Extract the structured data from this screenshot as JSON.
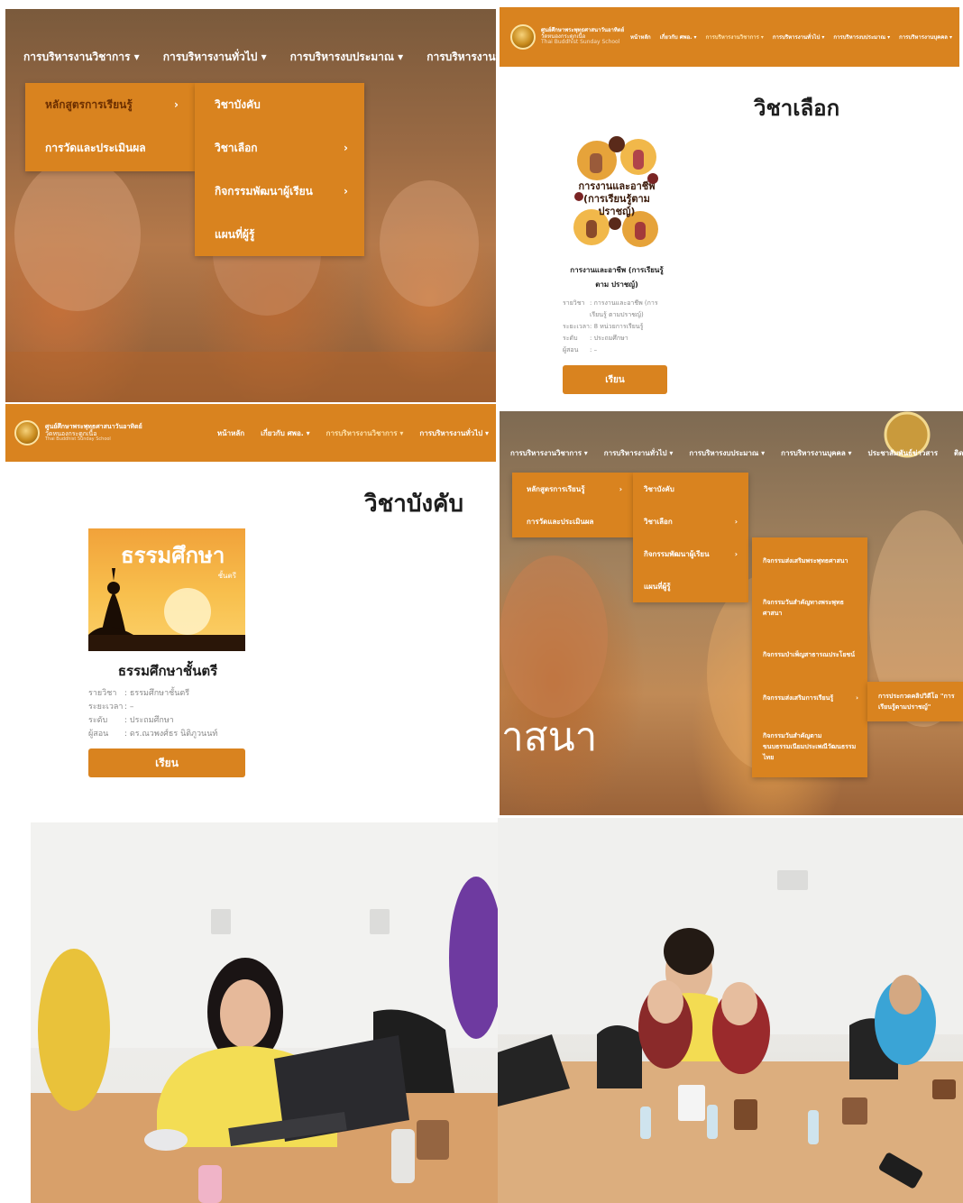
{
  "panel_menu_home": {
    "topnav": [
      {
        "label": "การบริหารงานวิชาการ ▾"
      },
      {
        "label": "การบริหารงานทั่วไป ▾"
      },
      {
        "label": "การบริหารงบประมาณ ▾"
      },
      {
        "label": "การบริหารงานบุคคล ▾"
      }
    ],
    "dropdown_level1": [
      {
        "label": "หลักสูตรการเรียนรู้",
        "arrow": "›"
      },
      {
        "label": "การวัดและประเมินผล",
        "arrow": ""
      }
    ],
    "dropdown_level2": [
      {
        "label": "วิชาบังคับ",
        "arrow": ""
      },
      {
        "label": "วิชาเลือก",
        "arrow": "›"
      },
      {
        "label": "กิจกรรมพัฒนาผู้เรียน",
        "arrow": "›"
      },
      {
        "label": "แผนที่ผู้รู้",
        "arrow": ""
      }
    ]
  },
  "panel_elective": {
    "header": {
      "brand_line1": "ศูนย์ศึกษาพระพุทธศาสนาวันอาทิตย์",
      "brand_line2": "วัดหนองกระดูกเนื้อ",
      "brand_line3": "Thai Buddhist Sunday School",
      "nav": [
        {
          "label": "หน้าหลัก"
        },
        {
          "label": "เกี่ยวกับ ศพอ. ▾"
        },
        {
          "label": "การบริหารงานวิชาการ ▾"
        },
        {
          "label": "การบริหารงานทั่วไป ▾"
        },
        {
          "label": "การบริหารงบประมาณ ▾"
        },
        {
          "label": "การบริหารงานบุคคล ▾"
        }
      ]
    },
    "title": "วิชาเลือก",
    "cover_text": "การงานและอาชีพ (การเรียนรู้ตามปราชญ์)",
    "course_name": "การงานและอาชีพ (การเรียนรู้ตาม ปราชญ์)",
    "meta": [
      {
        "k": "รายวิชา",
        "v": ": การงานและอาชีพ (การเรียนรู้ ตามปราชญ์)"
      },
      {
        "k": "ระยะเวลา",
        "v": ": 8 หน่วยการเรียนรู้"
      },
      {
        "k": "ระดับ",
        "v": ": ประถมศึกษา"
      },
      {
        "k": "ผู้สอน",
        "v": ": –"
      }
    ],
    "button": "เรียน"
  },
  "panel_compulsory": {
    "header": {
      "brand_line1": "ศูนย์ศึกษาพระพุทธศาสนาวันอาทิตย์",
      "brand_line2": "วัดหนองกระดูกเนื้อ",
      "brand_line3": "Thai Buddhist Sunday School",
      "nav": [
        {
          "label": "หน้าหลัก"
        },
        {
          "label": "เกี่ยวกับ ศพอ. ▾"
        },
        {
          "label": "การบริหารงานวิชาการ ▾"
        },
        {
          "label": "การบริหารงานทั่วไป ▾"
        }
      ]
    },
    "title": "วิชาบังคับ",
    "cover_title": "ธรรมศึกษา",
    "cover_sub": "ชั้นตรี",
    "course_name": "ธรรมศึกษาชั้นตรี",
    "meta": [
      {
        "k": "รายวิชา",
        "v": ": ธรรมศึกษาชั้นตรี"
      },
      {
        "k": "ระยะเวลา",
        "v": ": –"
      },
      {
        "k": "ระดับ",
        "v": ": ประถมศึกษา"
      },
      {
        "k": "ผู้สอน",
        "v": ": ดร.ณวพงศ์ธร นิติภูวนนท์"
      }
    ],
    "button": "เรียน"
  },
  "panel_menu_activity": {
    "topnav": [
      {
        "label": "การบริหารงานวิชาการ ▾"
      },
      {
        "label": "การบริหารงานทั่วไป ▾"
      },
      {
        "label": "การบริหารงบประมาณ ▾"
      },
      {
        "label": "การบริหารงานบุคคล ▾"
      },
      {
        "label": "ประชาสัมพันธ์ข่าวสาร"
      },
      {
        "label": "ติดต่อเรา"
      }
    ],
    "dropdown_level1": [
      {
        "label": "หลักสูตรการเรียนรู้",
        "arrow": "›"
      },
      {
        "label": "การวัดและประเมินผล",
        "arrow": ""
      }
    ],
    "dropdown_level2": [
      {
        "label": "วิชาบังคับ",
        "arrow": ""
      },
      {
        "label": "วิชาเลือก",
        "arrow": "›"
      },
      {
        "label": "กิจกรรมพัฒนาผู้เรียน",
        "arrow": "›"
      },
      {
        "label": "แผนที่ผู้รู้",
        "arrow": ""
      }
    ],
    "dropdown_level3": [
      {
        "label": "กิจกรรมส่งเสริมพระพุทธศาสนา",
        "arrow": ""
      },
      {
        "label": "กิจกรรมวันสำคัญทางพระพุทธศาสนา",
        "arrow": ""
      },
      {
        "label": "กิจกรรมบำเพ็ญสาธารณประโยชน์",
        "arrow": ""
      },
      {
        "label": "กิจกรรมส่งเสริมการเรียนรู้",
        "arrow": "›"
      },
      {
        "label": "กิจกรรมวันสำคัญตามขนบธรรมเนียมประเพณีวัฒนธรรมไทย",
        "arrow": ""
      }
    ],
    "dropdown_level4": [
      {
        "label": "การประกวดคลิปวิดีโอ \"การเรียนรู้ตามปราชญ์\""
      }
    ],
    "bg_text": "าสนา"
  }
}
